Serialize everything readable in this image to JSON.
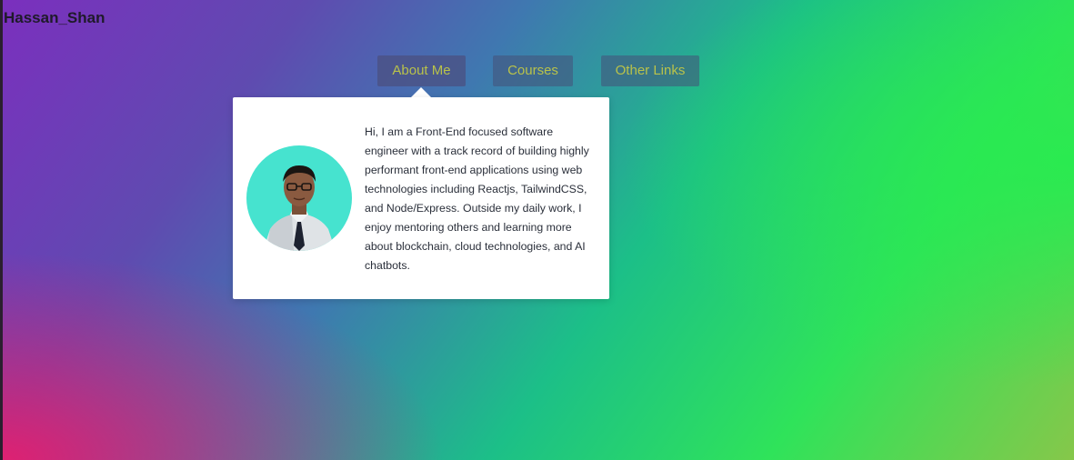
{
  "brand": {
    "name": "Hassan_Shan"
  },
  "nav": {
    "items": [
      {
        "label": "About Me",
        "active": true
      },
      {
        "label": "Courses",
        "active": false
      },
      {
        "label": "Other Links",
        "active": false
      }
    ]
  },
  "about_popover": {
    "avatar_icon": "profile-photo",
    "bio": "Hi, I am a Front-End focused software engineer with a track record of building highly performant front-end applications using web technologies including Reactjs, TailwindCSS, and Node/Express. Outside my daily work, I enjoy mentoring others and learning more about blockchain, cloud technologies, and AI chatbots."
  },
  "colors": {
    "nav_text": "#b9c24a",
    "avatar_bg": "#46e3cf",
    "popover_bg": "#ffffff"
  }
}
